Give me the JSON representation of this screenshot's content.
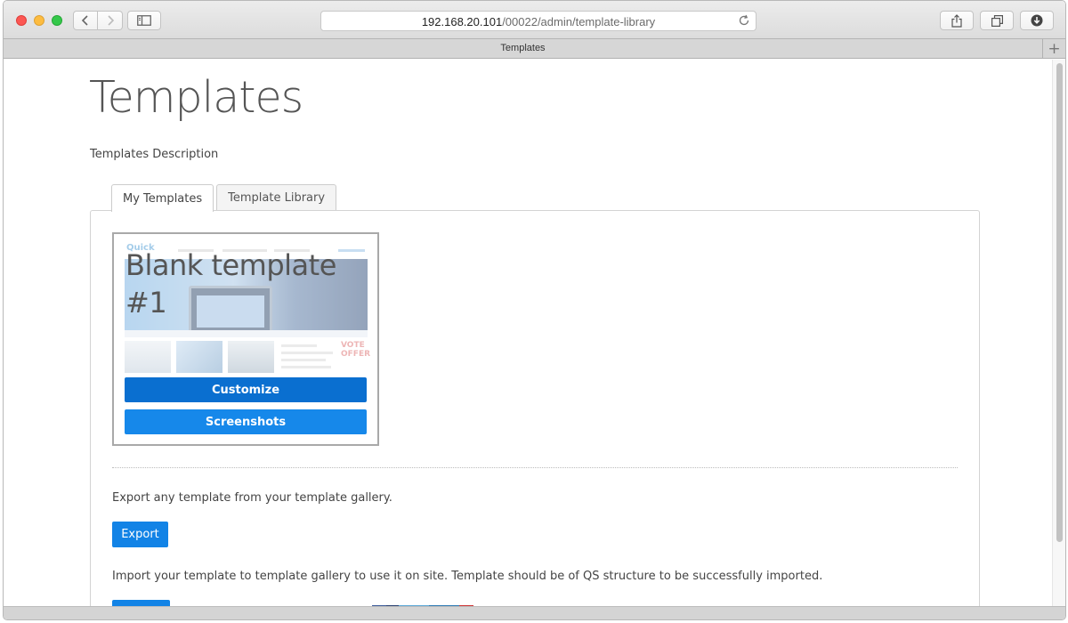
{
  "browser": {
    "url_host": "192.168.20.101",
    "url_path": "/00022/admin/template-library",
    "tab_title": "Templates",
    "new_tab_symbol": "+"
  },
  "page": {
    "title": "Templates",
    "description": "Templates Description"
  },
  "tabs": [
    {
      "label": "My Templates",
      "active": true
    },
    {
      "label": "Template Library",
      "active": false
    }
  ],
  "template_card": {
    "title": "Blank template #1",
    "preview_logo": "Quick",
    "preview_badge": "VOTE OFFER",
    "customize_label": "Customize",
    "screenshots_label": "Screenshots"
  },
  "export": {
    "text": "Export any template from your template gallery.",
    "button_label": "Export"
  },
  "import": {
    "text": "Import your template to template gallery to use it on site. Template should be of QS structure to be successfully imported."
  },
  "colors": {
    "primary_button": "#0a6fd0",
    "secondary_button": "#1688ea",
    "export_button": "#1283e6"
  }
}
